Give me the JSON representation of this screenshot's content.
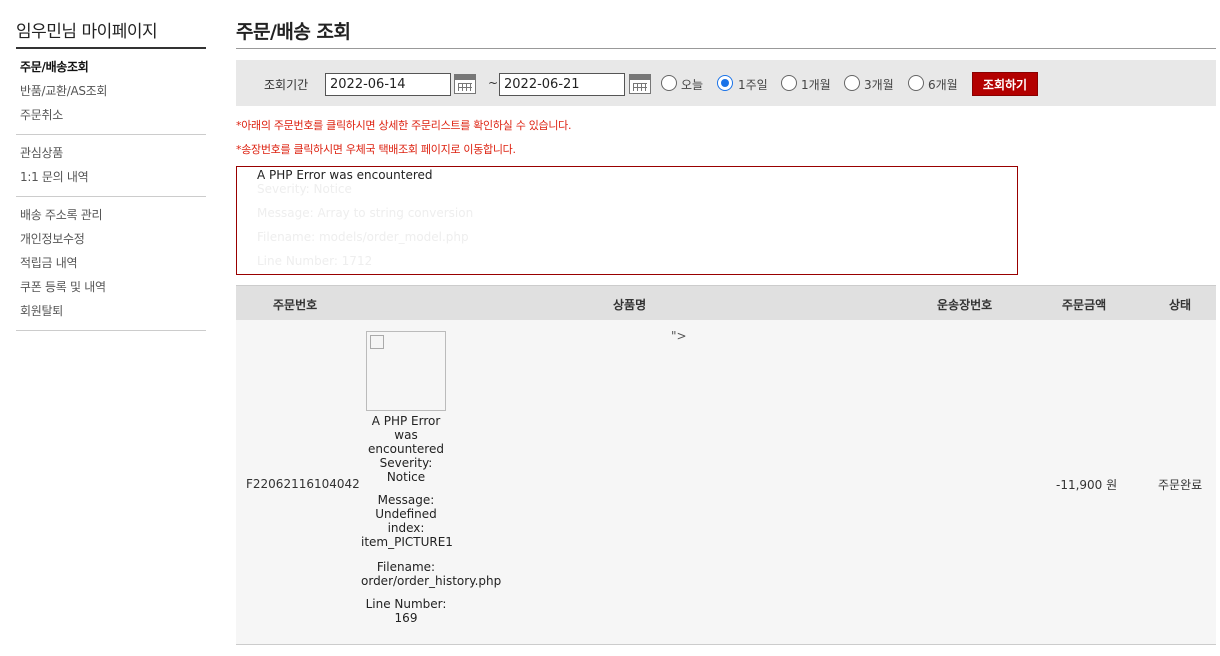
{
  "sidebar": {
    "title": "임우민님 마이페이지",
    "groups": [
      [
        "주문/배송조회",
        "반품/교환/AS조회",
        "주문취소"
      ],
      [
        "관심상품",
        "1:1 문의 내역"
      ],
      [
        "배송 주소록 관리",
        "개인정보수정",
        "적립금 내역",
        "쿠폰 등록 및 내역",
        "회원탈퇴"
      ]
    ]
  },
  "page": {
    "title": "주문/배송 조회"
  },
  "search": {
    "label": "조회기간",
    "start_date": "2022-06-14",
    "tilde": "~",
    "end_date": "2022-06-21",
    "periods": [
      "오늘",
      "1주일",
      "1개월",
      "3개월",
      "6개월"
    ],
    "selected_period": "1주일",
    "button": "조회하기"
  },
  "notices": [
    "*아래의 주문번호를 클릭하시면 상세한 주문리스트를 확인하실 수 있습니다.",
    "*송장번호를 클릭하시면 우체국 택배조회 페이지로 이동합니다."
  ],
  "php_error": {
    "heading": "A PHP Error was encountered",
    "faint_lines": [
      "Severity: Notice",
      "Message: Array to string conversion",
      "Filename: models/order_model.php",
      "Line Number: 1712"
    ]
  },
  "table": {
    "headers": [
      "주문번호",
      "상품명",
      "운송장번호",
      "주문금액",
      "상태"
    ],
    "row": {
      "order_no": "F22062116104042",
      "error_lines": [
        "A PHP Error was encountered",
        "Severity: Notice",
        "Message: Undefined index: item_PICTURE1",
        "Filename: order/order_history.php",
        "Line Number: 169"
      ],
      "stray_text": "\">",
      "amount": "-11,900 원",
      "status": "주문완료"
    }
  }
}
